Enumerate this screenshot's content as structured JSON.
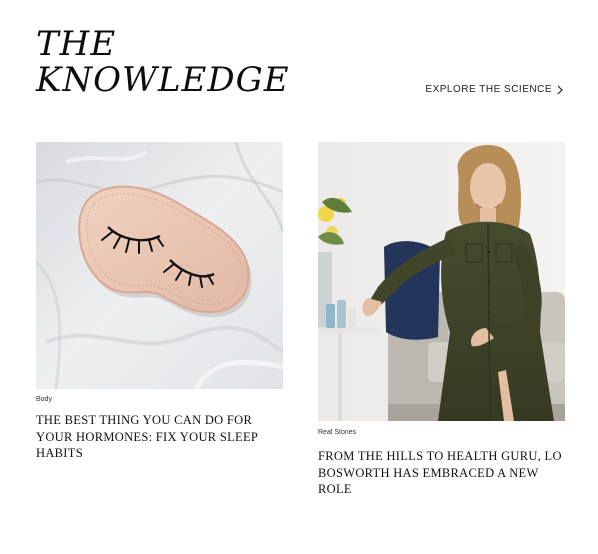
{
  "section": {
    "title_line1": "THE",
    "title_line2": "KNOWLEDGE",
    "explore_label": "EXPLORE THE SCIENCE"
  },
  "articles": [
    {
      "category": "Body",
      "title": "THE BEST THING YOU CAN DO FOR YOUR HORMONES: FIX YOUR SLEEP HABITS",
      "image": "pink-sleep-mask-with-eyelashes-on-white-sheets"
    },
    {
      "category": "Real Stories",
      "title": "FROM THE HILLS TO HEALTH GURU, LO BOSWORTH HAS EMBRACED A NEW ROLE",
      "image": "woman-in-olive-dress-seated-on-grey-sofa"
    }
  ],
  "colors": {
    "text": "#111111",
    "mask_pink": "#e8c4b2",
    "dress_olive": "#3f4327",
    "sofa_grey": "#c8c3bb",
    "pillow_navy": "#23355a"
  }
}
